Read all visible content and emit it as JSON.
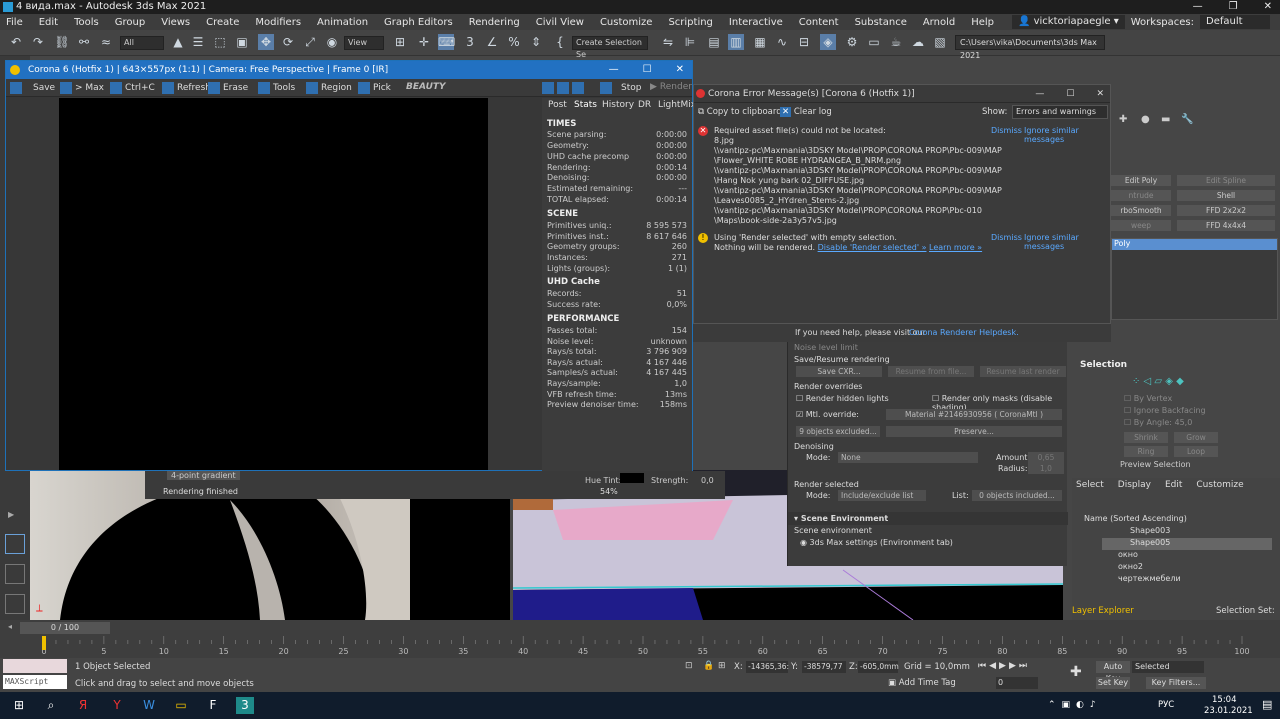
{
  "window": {
    "title": "4 вида.max - Autodesk 3ds Max 2021"
  },
  "menu": {
    "items": [
      "File",
      "Edit",
      "Tools",
      "Group",
      "Views",
      "Create",
      "Modifiers",
      "Animation",
      "Graph Editors",
      "Rendering",
      "Civil View",
      "Customize",
      "Scripting",
      "Interactive",
      "Content",
      "Substance",
      "Arnold",
      "Help"
    ],
    "user": "vicktoriapaegle",
    "workspaces_label": "Workspaces:",
    "workspace": "Default"
  },
  "toolbar": {
    "filter": "All",
    "view": "View",
    "selection_set": "Create Selection Se",
    "path": "C:\\Users\\vika\\Documents\\3ds Max 2021"
  },
  "vfb": {
    "title": "Corona 6 (Hotfix 1) | 643×557px (1:1) | Camera: Free Perspective | Frame 0 [IR]",
    "tools": {
      "save": "Save",
      "to_max": "> Max",
      "ctrl_c": "Ctrl+C",
      "refresh": "Refresh",
      "erase": "Erase",
      "tools": "Tools",
      "region": "Region",
      "pick": "Pick",
      "beauty": "BEAUTY",
      "stop": "Stop",
      "render": "Render"
    },
    "tabs": [
      "Post",
      "Stats",
      "History",
      "DR",
      "LightMix"
    ],
    "stats": {
      "times_h": "TIMES",
      "times": [
        {
          "k": "Scene parsing:",
          "v": "0:00:00"
        },
        {
          "k": "Geometry:",
          "v": "0:00:00"
        },
        {
          "k": "UHD cache precomp",
          "v": "0:00:00"
        },
        {
          "k": "Rendering:",
          "v": "0:00:14"
        },
        {
          "k": "Denoising:",
          "v": "0:00:00"
        },
        {
          "k": "Estimated remaining:",
          "v": "---"
        },
        {
          "k": "TOTAL elapsed:",
          "v": "0:00:14"
        }
      ],
      "scene_h": "SCENE",
      "scene": [
        {
          "k": "Primitives uniq.:",
          "v": "8 595 573"
        },
        {
          "k": "Primitives inst.:",
          "v": "8 617 646"
        },
        {
          "k": "Geometry groups:",
          "v": "260"
        },
        {
          "k": "Instances:",
          "v": "271"
        },
        {
          "k": "Lights (groups):",
          "v": "1 (1)"
        }
      ],
      "uhd_h": "UHD Cache",
      "uhd": [
        {
          "k": "Records:",
          "v": "51"
        },
        {
          "k": "Success rate:",
          "v": "0,0%"
        }
      ],
      "perf_h": "PERFORMANCE",
      "perf": [
        {
          "k": "Passes total:",
          "v": "154"
        },
        {
          "k": "Noise level:",
          "v": "unknown"
        },
        {
          "k": "Rays/s total:",
          "v": "3 796 909"
        },
        {
          "k": "Rays/s actual:",
          "v": "4 167 446"
        },
        {
          "k": "Samples/s actual:",
          "v": "4 167 445"
        },
        {
          "k": "Rays/sample:",
          "v": "1,0"
        },
        {
          "k": "VFB refresh time:",
          "v": "13ms"
        },
        {
          "k": "Preview denoiser time:",
          "v": "158ms"
        }
      ]
    }
  },
  "error": {
    "title": "Corona Error Message(s)   [Corona 6 (Hotfix 1)]",
    "copy": "Copy to clipboard",
    "clear": "Clear log",
    "show_label": "Show:",
    "show_value": "Errors and warnings",
    "msg1_lines": [
      "Required asset file(s) could not be located:",
      "8.jpg",
      "\\\\vantipz-pc\\Maxmania\\3DSKY Model\\PROP\\CORONA PROP\\Pbc-009\\MAP",
      "\\Flower_WHITE ROBE HYDRANGEA_B_NRM.png",
      "\\\\vantipz-pc\\Maxmania\\3DSKY Model\\PROP\\CORONA PROP\\Pbc-009\\MAP",
      "\\Hang Nok yung bark 02_DIFFUSE.jpg",
      "\\\\vantipz-pc\\Maxmania\\3DSKY Model\\PROP\\CORONA PROP\\Pbc-009\\MAP",
      "\\Leaves0085_2_HYdren_Stems-2.jpg",
      "\\\\vantipz-pc\\Maxmania\\3DSKY Model\\PROP\\CORONA PROP\\Pbc-010",
      "\\Maps\\book-side-2a3y57v5.jpg"
    ],
    "msg2_line1": "Using 'Render selected' with empty selection.",
    "msg2_line2": "Nothing will be rendered.",
    "msg2_link1": "Disable 'Render selected' »",
    "msg2_link2": "Learn more »",
    "dismiss": "Dismiss",
    "ignore": "Ignore similar messages",
    "help": "If you need help, please visit our",
    "helpdesk": "Corona Renderer Helpdesk."
  },
  "modifiers": {
    "buttons": [
      "Edit Poly",
      "Edit Spline",
      "ntrude",
      "Shell",
      "rboSmooth",
      "FFD 2x2x2",
      "weep",
      "FFD 4x4x4"
    ],
    "selected": "Poly"
  },
  "render_setup": {
    "save_resume": "Save/Resume rendering",
    "save_cxr": "Save CXR...",
    "resume_file": "Resume from file...",
    "resume_last": "Resume last render",
    "overrides": "Render overrides",
    "hidden_lights": "Render hidden lights",
    "only_masks": "Render only masks (disable shading)",
    "mtl_override": "Mtl. override:",
    "material": "Material #2146930956  ( CoronaMtl )",
    "excluded": "9 objects excluded...",
    "preserve": "Preserve...",
    "denoising": "Denoising",
    "mode_label": "Mode:",
    "mode_value": "None",
    "amount_label": "Amount:",
    "amount_value": "0,65",
    "radius_label": "Radius:",
    "radius_value": "1,0",
    "render_selected": "Render selected",
    "rs_mode": "Include/exclude list",
    "list_label": "List:",
    "list_value": "0 objects included...",
    "scene_env": "Scene Environment",
    "scene_env_sub": "Scene environment",
    "env_settings": "3ds Max settings (Environment tab)",
    "noise_text": "Noise level limit"
  },
  "selection": {
    "title": "Selection",
    "by_vertex": "By Vertex",
    "ignore_backfacing": "Ignore Backfacing",
    "by_angle": "By Angle:",
    "angle": "45,0",
    "shrink": "Shrink",
    "grow": "Grow",
    "ring": "Ring",
    "loop": "Loop",
    "preview": "Preview Selection"
  },
  "scene_explorer": {
    "tabs": [
      "Select",
      "Display",
      "Edit",
      "Customize"
    ],
    "sort": "Name (Sorted Ascending)",
    "items": [
      "Shape003",
      "Shape005",
      "окно",
      "окно2",
      "чертежмебели"
    ],
    "layer_explorer": "Layer Explorer",
    "selection_set": "Selection Set:"
  },
  "vfb_under": {
    "gradient": "4-point gradient",
    "hue": "Hue Tint:",
    "strength": "Strength:",
    "strength_val": "0,0",
    "rendering_finished": "Rendering finished",
    "zoom": "54%"
  },
  "timeline": {
    "frame": "0 / 100",
    "ticks": [
      "0",
      "5",
      "10",
      "15",
      "20",
      "25",
      "30",
      "35",
      "40",
      "45",
      "50",
      "55",
      "60",
      "65",
      "70",
      "75",
      "80",
      "85",
      "90",
      "95",
      "100"
    ]
  },
  "status": {
    "maxscript": "MAXScript Mi:",
    "selected": "1 Object Selected",
    "hint": "Click and drag to select and move objects",
    "x_label": "X:",
    "x": "-14365,36:",
    "y_label": "Y:",
    "y": "-38579,77",
    "z_label": "Z:",
    "z": "-605,0mm",
    "grid": "Grid = 10,0mm",
    "add_time_tag": "Add Time Tag",
    "auto_key": "Auto Key",
    "set_key": "Set Key",
    "selected_dd": "Selected",
    "key_filters": "Key Filters...",
    "frame_field": "0"
  },
  "taskbar": {
    "time": "15:04",
    "date": "23.01.2021",
    "lang": "РУС"
  },
  "colors": {
    "accent": "#2271c2",
    "error": "#dd3333",
    "warning": "#f0c000",
    "link": "#5aa9ff"
  }
}
